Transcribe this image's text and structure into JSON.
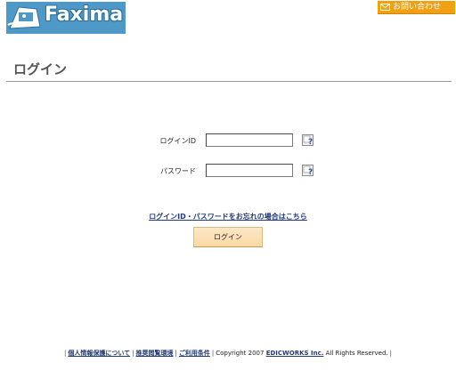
{
  "header": {
    "logo_text": "Faxima",
    "contact_label": "お問い合わせ"
  },
  "page": {
    "title": "ログイン"
  },
  "form": {
    "login_id_label": "ログインID",
    "login_id_value": "",
    "password_label": "パスワード",
    "password_value": "",
    "help_icon": "help-question-icon",
    "forgot_link": "ログインID・パスワードをお忘れの場合はこちら",
    "login_button": "ログイン"
  },
  "footer": {
    "privacy_link": "個人情報保護について",
    "env_link": "推奨閲覧環境",
    "terms_link": "ご利用条件",
    "copyright_prefix": "Copyright 2007",
    "company_link": "EDICWORKS Inc.",
    "rights": "All Rights Reserved."
  },
  "colors": {
    "logo_bg": "#4f99c9",
    "contact_bg": "#f0a012",
    "login_button_bg": "#fbd9a4",
    "link": "#223a73"
  }
}
